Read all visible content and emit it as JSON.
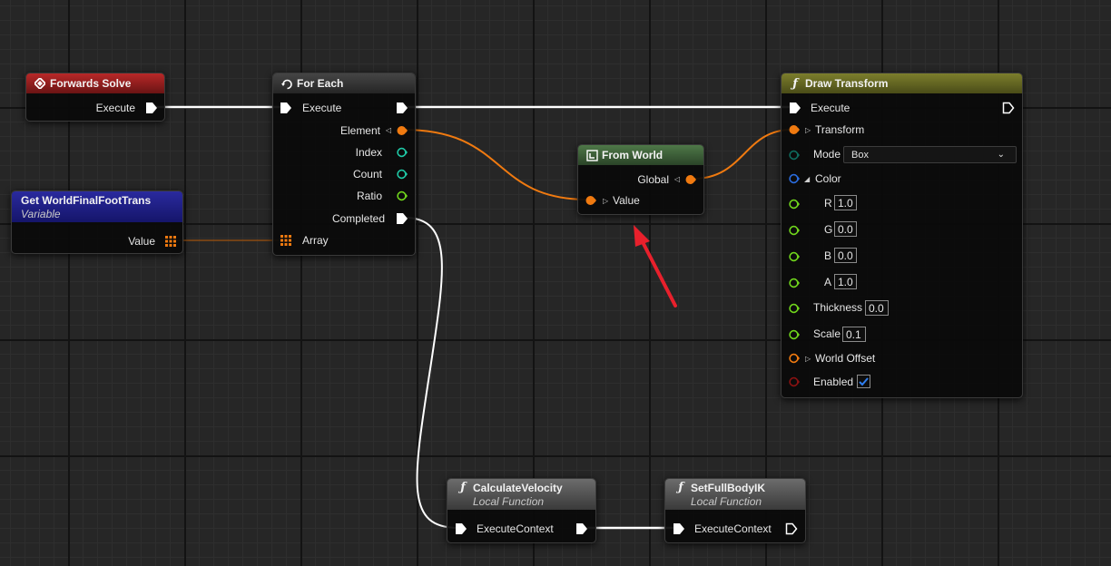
{
  "nodes": {
    "forwards_solve": {
      "title": "Forwards Solve",
      "exec_label": "Execute"
    },
    "get_variable": {
      "title": "Get WorldFinalFootTrans",
      "subtitle": "Variable",
      "value_label": "Value"
    },
    "for_each": {
      "title": "For Each",
      "execute_label": "Execute",
      "element_label": "Element",
      "index_label": "Index",
      "count_label": "Count",
      "ratio_label": "Ratio",
      "completed_label": "Completed",
      "array_label": "Array"
    },
    "from_world": {
      "title": "From World",
      "global_label": "Global",
      "value_label": "Value"
    },
    "draw_transform": {
      "title": "Draw Transform",
      "execute_label": "Execute",
      "transform_label": "Transform",
      "mode_label": "Mode",
      "mode_value": "Box",
      "color_label": "Color",
      "r_label": "R",
      "r_value": "1.0",
      "g_label": "G",
      "g_value": "0.0",
      "b_label": "B",
      "b_value": "0.0",
      "a_label": "A",
      "a_value": "1.0",
      "thickness_label": "Thickness",
      "thickness_value": "0.0",
      "scale_label": "Scale",
      "scale_value": "0.1",
      "world_offset_label": "World Offset",
      "enabled_label": "Enabled",
      "enabled": true
    },
    "calculate_velocity": {
      "title": "CalculateVelocity",
      "subtitle": "Local Function",
      "context_label": "ExecuteContext"
    },
    "set_full_body_ik": {
      "title": "SetFullBodyIK",
      "subtitle": "Local Function",
      "context_label": "ExecuteContext"
    }
  },
  "colors": {
    "exec": "#ffffff",
    "transform": "#f07a10",
    "int": "#1fc9a6",
    "float": "#70d51c",
    "color": "#2a6cde",
    "bool": "#8a1212",
    "annotation": "#e8202c"
  }
}
